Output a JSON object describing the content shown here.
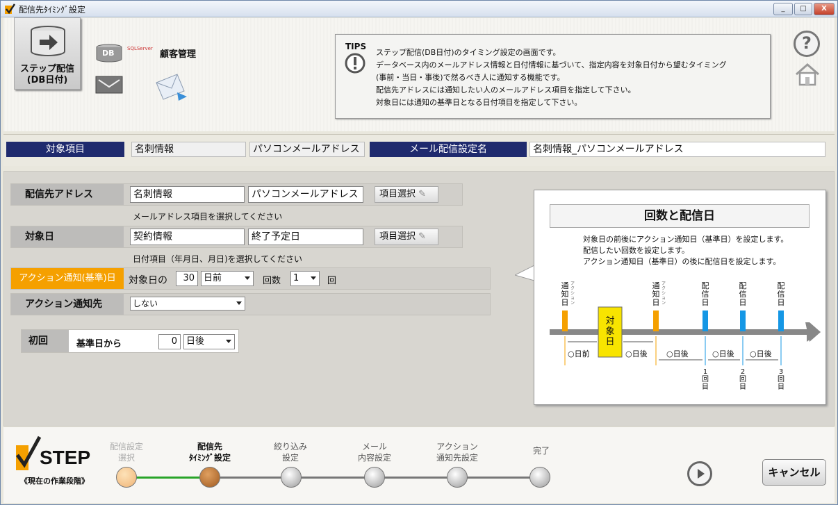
{
  "window": {
    "title": "配信先ﾀｲﾐﾝｸﾞ設定",
    "min": "_",
    "max": "□",
    "close": "X"
  },
  "toolbar": {
    "step_button_line1": "ステップ配信",
    "step_button_line2": "(DB日付)",
    "db_label": "DB",
    "sql_label": "SQLServer",
    "customer_label": "顧客管理"
  },
  "tips": {
    "heading": "TIPS",
    "lines": [
      "ステップ配信(DB日付)のタイミング設定の画面です。",
      "データベース内のメールアドレス情報と日付情報に基づいて、指定内容を対象日付から望むタイミング",
      "(事前・当日・事後)で然るべき人に通知する機能です。",
      "配信先アドレスには通知したい人のメールアドレス項目を指定して下さい。",
      "対象日には通知の基準日となる日付項目を指定して下さい。"
    ]
  },
  "header": {
    "target_label": "対象項目",
    "target_table": "名刺情報",
    "target_field": "パソコンメールアドレス",
    "mail_setting_label": "メール配信設定名",
    "mail_setting_value": "名刺情報_パソコンメールアドレス"
  },
  "form": {
    "address_label": "配信先アドレス",
    "address_table": "名刺情報",
    "address_field": "パソコンメールアドレス",
    "select_button": "項目選択",
    "address_hint": "メールアドレス項目を選択してください",
    "date_label": "対象日",
    "date_table": "契約情報",
    "date_field": "終了予定日",
    "date_hint": "日付項目（年月日、月日)を選択してください",
    "action_label": "アクション通知(基準)日",
    "action_prefix": "対象日の",
    "action_days": "30",
    "action_when": "日前",
    "action_count_label": "回数",
    "action_count": "1",
    "action_count_unit": "回",
    "notify_label": "アクション通知先",
    "notify_value": "しない",
    "first_label": "初回",
    "first_base": "基準日から",
    "first_days": "0",
    "first_when": "日後"
  },
  "panel": {
    "title": "回数と配信日",
    "desc": [
      "対象日の前後にアクション通知日（基準日）を設定します。",
      "配信したい回数を設定します。",
      "アクション通知日（基準日）の後に配信日を設定します。"
    ],
    "notify_label": "通知日",
    "action_small": "アクション",
    "target_day": "対象日",
    "haishin": "配信日",
    "before": "○日前",
    "after": "○日後",
    "n1": "1回目",
    "n2": "2回目",
    "n3": "3回目"
  },
  "steps": {
    "step_title": "STEP",
    "current_stage": "《現在の作業段階》",
    "items": [
      {
        "line1": "配信設定",
        "line2": "選択"
      },
      {
        "line1": "配信先",
        "line2": "ﾀｲﾐﾝｸﾞ設定"
      },
      {
        "line1": "絞り込み",
        "line2": "設定"
      },
      {
        "line1": "メール",
        "line2": "内容設定"
      },
      {
        "line1": "アクション",
        "line2": "通知先設定"
      },
      {
        "line1": "完了",
        "line2": ""
      }
    ]
  },
  "buttons": {
    "cancel": "キャンセル"
  },
  "colors": {
    "navy": "#1f2a6e",
    "orange": "#f5a000",
    "blue_marker": "#1597e5",
    "green_line": "#28a428"
  }
}
